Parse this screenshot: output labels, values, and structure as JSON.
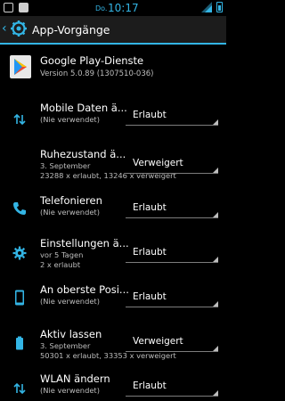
{
  "statusbar": {
    "day": "Do.",
    "time": "10:17"
  },
  "actionbar": {
    "title": "App-Vorgänge"
  },
  "app": {
    "name": "Google Play-Dienste",
    "version": "Version 5.0.89 (1307510-036)"
  },
  "operations": [
    {
      "title": "Mobile Daten ä...",
      "lines": [
        "(Nie verwendet)"
      ],
      "value": "Erlaubt",
      "icon": "sync-arrows-icon"
    },
    {
      "title": "Ruhezustand ä...",
      "lines": [
        "3. September",
        "23288 x erlaubt, 13246 x verweigert"
      ],
      "value": "Verweigert",
      "icon": "none"
    },
    {
      "title": "Telefonieren",
      "lines": [
        "(Nie verwendet)"
      ],
      "value": "Erlaubt",
      "icon": "phone-icon"
    },
    {
      "title": "Einstellungen ä...",
      "lines": [
        "vor 5 Tagen",
        "2 x erlaubt"
      ],
      "value": "Erlaubt",
      "icon": "settings-gear-icon"
    },
    {
      "title": "An oberste Posi...",
      "lines": [
        "(Nie verwendet)"
      ],
      "value": "Erlaubt",
      "icon": "phone-device-icon"
    },
    {
      "title": "Aktiv lassen",
      "lines": [
        "3. September",
        "50301 x erlaubt, 33353 x verweigert"
      ],
      "value": "Verweigert",
      "icon": "battery-icon"
    },
    {
      "title": "WLAN ändern",
      "lines": [
        "(Nie verwendet)"
      ],
      "value": "Erlaubt",
      "icon": "sync-arrows-icon"
    }
  ],
  "colors": {
    "accent": "#33b5e5",
    "background": "#000000",
    "secondary_text": "#bdbdbd"
  }
}
